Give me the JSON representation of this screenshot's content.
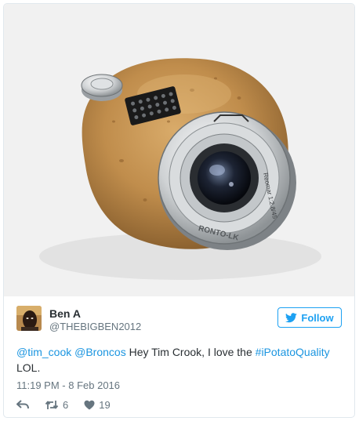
{
  "tweet": {
    "author": {
      "name": "Ben A",
      "handle": "@THEBIGBEN2012"
    },
    "follow_label": "Follow",
    "text": {
      "mention1": "@tim_cook",
      "mention2": "@Broncos",
      "body": "Hey Tim Crook, I love the",
      "hashtag": "#iPotatoQuality",
      "tail": "LOL."
    },
    "timestamp": "11:19 PM - 8 Feb 2016",
    "retweets": "6",
    "likes": "19",
    "camera_brand": "RONTO-LK",
    "lens_text": "Reomar 1:2.8/45"
  },
  "colors": {
    "accent": "#1da1f2",
    "link": "#1b95e0",
    "text": "#292f33",
    "muted": "#66757f",
    "border": "#e1e8ed"
  },
  "icons": [
    "twitter-bird-icon",
    "reply-icon",
    "retweet-icon",
    "heart-icon"
  ]
}
